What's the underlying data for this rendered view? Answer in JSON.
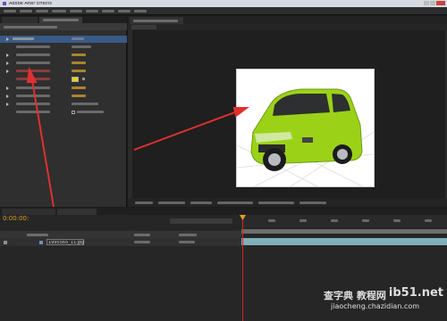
{
  "window": {
    "title": "Adobe After Effects"
  },
  "left_panel": {
    "effect_rows": 8,
    "layer_swatch": "#e9d400"
  },
  "viewer": {
    "canvas_color": "#ffffff",
    "car_color": "#9bd218"
  },
  "timeline": {
    "current_time": "0:00:00:00",
    "layer_name": "1995565_11.jpg",
    "track_color": "#7fb0b9"
  },
  "watermark": {
    "line1": "ib51.net",
    "line2": "jiaocheng.chazidian.com",
    "line3": "查字典 教程网"
  },
  "annotations": {
    "arrow_color": "#e03030"
  }
}
